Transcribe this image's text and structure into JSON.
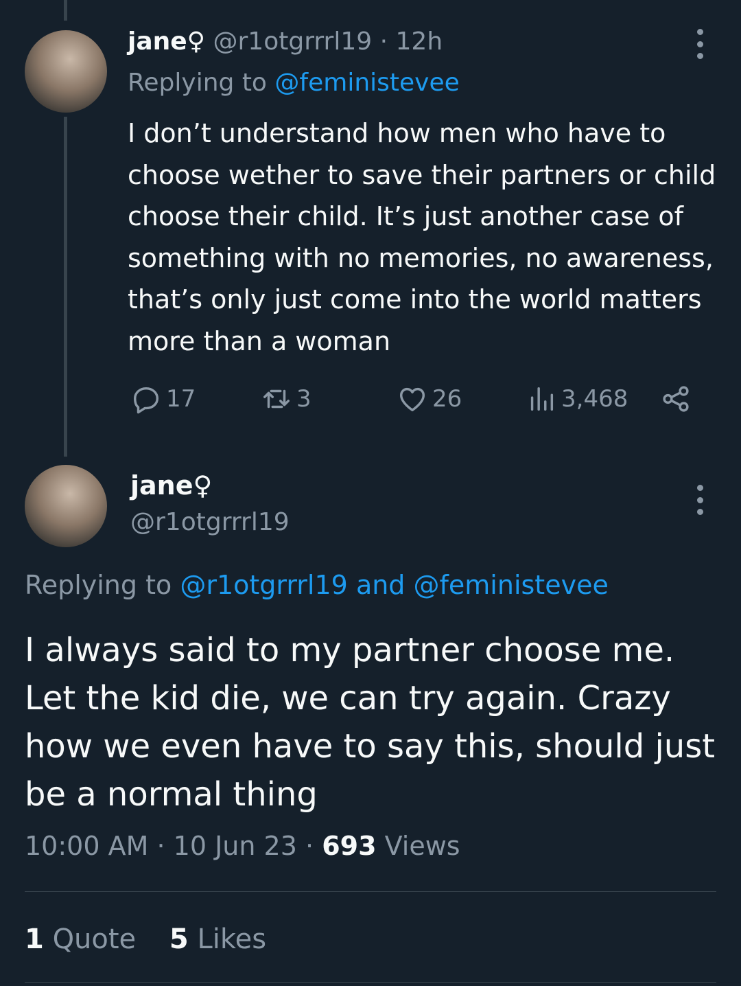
{
  "tweet1": {
    "name": "jane♀",
    "handle": "@r1otgrrrl19",
    "sep": "·",
    "time": "12h",
    "replying_prefix": "Replying to",
    "replying_to": "@feministevee",
    "body": "I don’t understand how men who have to choose wether to save their partners or child choose their child. It’s just another case of something with no memories, no awareness, that’s only just come into the world matters more than a woman",
    "replies": "17",
    "retweets": "3",
    "likes": "26",
    "views": "3,468"
  },
  "tweet2": {
    "name": "jane♀",
    "handle": "@r1otgrrrl19",
    "replying_prefix": "Replying to",
    "replying_to_1": "@r1otgrrrl19",
    "and": "and",
    "replying_to_2": "@feministevee",
    "body": "I always said to my partner choose me. Let the kid die, we can try again. Crazy how we even have to say this, should just be a normal thing",
    "time": "10:00 AM",
    "sep": "·",
    "date": "10 Jun 23",
    "views_count": "693",
    "views_label": "Views"
  },
  "stats": {
    "quotes_count": "1",
    "quotes_label": "Quote",
    "likes_count": "5",
    "likes_label": "Likes"
  },
  "colors": {
    "background": "#15202b",
    "text": "#f7f9f9",
    "secondary": "#8b98a5",
    "link": "#1d9bf0"
  },
  "icons": [
    "reply-icon",
    "retweet-icon",
    "like-icon",
    "views-icon",
    "share-icon",
    "more-icon"
  ]
}
